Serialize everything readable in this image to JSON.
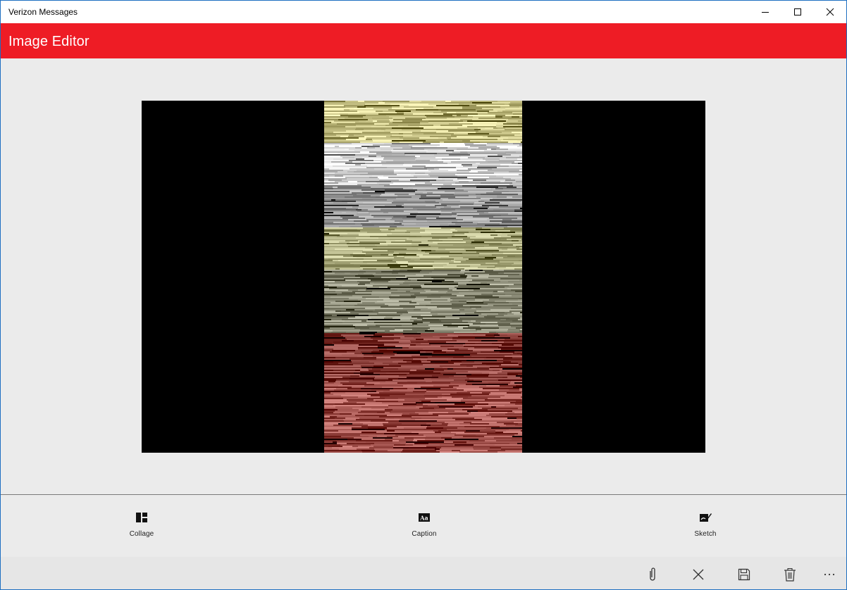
{
  "window": {
    "title": "Verizon Messages",
    "controls": [
      "minimize-icon",
      "maximize-icon",
      "close-icon"
    ]
  },
  "header": {
    "title": "Image Editor",
    "background": "#ee1c25"
  },
  "tools": [
    {
      "icon": "collage-icon",
      "label": "Collage"
    },
    {
      "icon": "caption-icon",
      "label": "Caption"
    },
    {
      "icon": "sketch-icon",
      "label": "Sketch"
    }
  ],
  "commandbar": {
    "buttons": [
      "attach-icon",
      "discard-icon",
      "save-icon",
      "delete-icon",
      "more-icon"
    ]
  }
}
